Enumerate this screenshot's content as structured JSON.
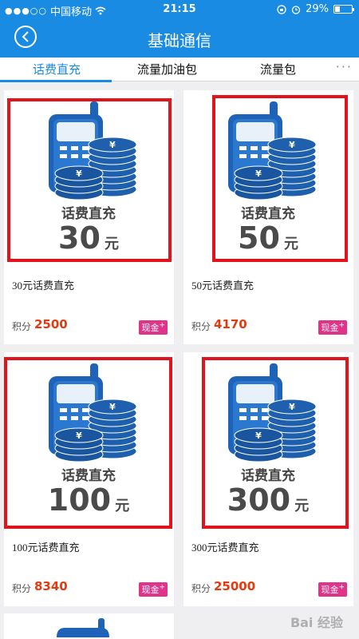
{
  "status_bar": {
    "carrier": "中国移动",
    "time": "21:15",
    "battery": "29%",
    "battery_level": 0.29
  },
  "header": {
    "title": "基础通信"
  },
  "tabs": [
    {
      "label": "话费直充",
      "active": true
    },
    {
      "label": "流量加油包",
      "active": false
    },
    {
      "label": "流量包",
      "active": false
    }
  ],
  "more_label": "···",
  "points_label": "积分",
  "cash_label": "现金",
  "cash_plus": "+",
  "recharge_image_text": "话费直充",
  "unit_yuan": "元",
  "products": [
    {
      "amount": "30",
      "title": "30元话费直充",
      "points": "2500"
    },
    {
      "amount": "50",
      "title": "50元话费直充",
      "points": "4170"
    },
    {
      "amount": "100",
      "title": "100元话费直充",
      "points": "8340"
    },
    {
      "amount": "300",
      "title": "300元话费直充",
      "points": "25000"
    }
  ],
  "watermark": "Bai 经验",
  "colors": {
    "brand": "#1a8be2",
    "points": "#e53a10",
    "cash_badge": "#e0338a",
    "frame": "#e0141c"
  }
}
